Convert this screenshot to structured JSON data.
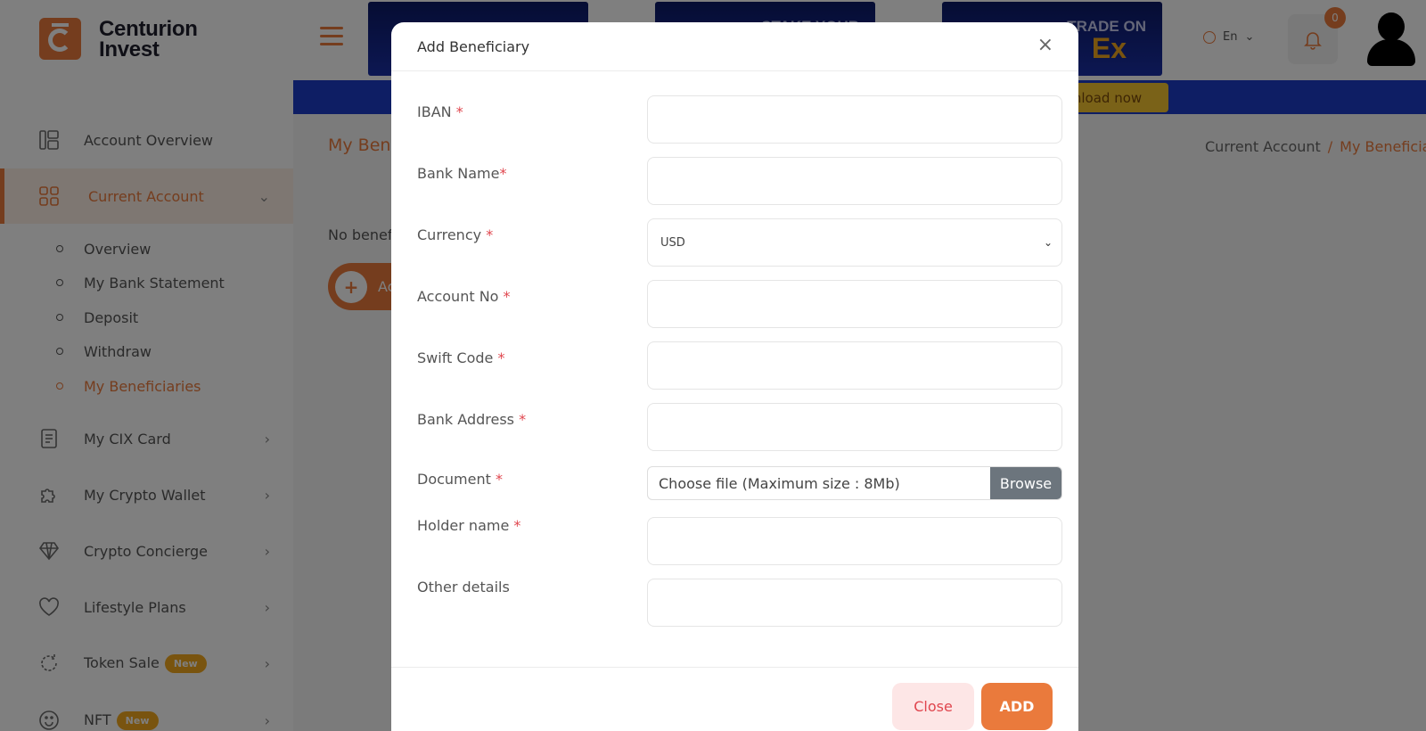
{
  "brand": {
    "name_line1": "Centurion",
    "name_line2": "Invest"
  },
  "sidebar": {
    "items": [
      {
        "label": "Account Overview",
        "icon": "layout-icon"
      },
      {
        "label": "Current Account",
        "icon": "grid-icon"
      },
      {
        "label": "My CIX Card",
        "icon": "document-icon"
      },
      {
        "label": "My Crypto Wallet",
        "icon": "puzzle-icon"
      },
      {
        "label": "Crypto Concierge",
        "icon": "diamond-icon"
      },
      {
        "label": "Lifestyle Plans",
        "icon": "heart-icon"
      },
      {
        "label": "Token Sale",
        "icon": "refresh-icon",
        "badge": "New"
      },
      {
        "label": "NFT",
        "icon": "smile-icon",
        "badge": "New"
      }
    ],
    "sub_items": [
      {
        "label": "Overview"
      },
      {
        "label": "My Bank Statement"
      },
      {
        "label": "Deposit"
      },
      {
        "label": "Withdraw"
      },
      {
        "label": "My Beneficiaries"
      }
    ]
  },
  "header": {
    "banners": [
      {
        "text": ""
      },
      {
        "text": "STAKE YOUR"
      },
      {
        "text": "TRADE ON",
        "big": "Ex"
      }
    ],
    "language": "En",
    "notification_count": "0",
    "download_label": "ynload now"
  },
  "page": {
    "title": "My Bene",
    "breadcrumb_parent": "Current Account",
    "breadcrumb_separator": "/",
    "breadcrumb_current": "My Beneficia",
    "empty_text": "No benefi",
    "add_button_label": "Ac"
  },
  "modal": {
    "title": "Add Beneficiary",
    "close_x": "×",
    "fields": {
      "iban": "IBAN",
      "bank_name": "Bank Name",
      "currency": "Currency",
      "currency_value": "USD",
      "account_no": "Account No",
      "swift_code": "Swift Code",
      "bank_address": "Bank Address",
      "document": "Document",
      "document_placeholder": "Choose file (Maximum size : 8Mb)",
      "browse": "Browse",
      "holder_name": "Holder name",
      "other_details": "Other details"
    },
    "required_mark": "*",
    "close_button": "Close",
    "add_button": "ADD"
  },
  "colors": {
    "accent": "#ea7a3c",
    "required": "#e0464e",
    "banner_blue": "#1c3cc8"
  }
}
